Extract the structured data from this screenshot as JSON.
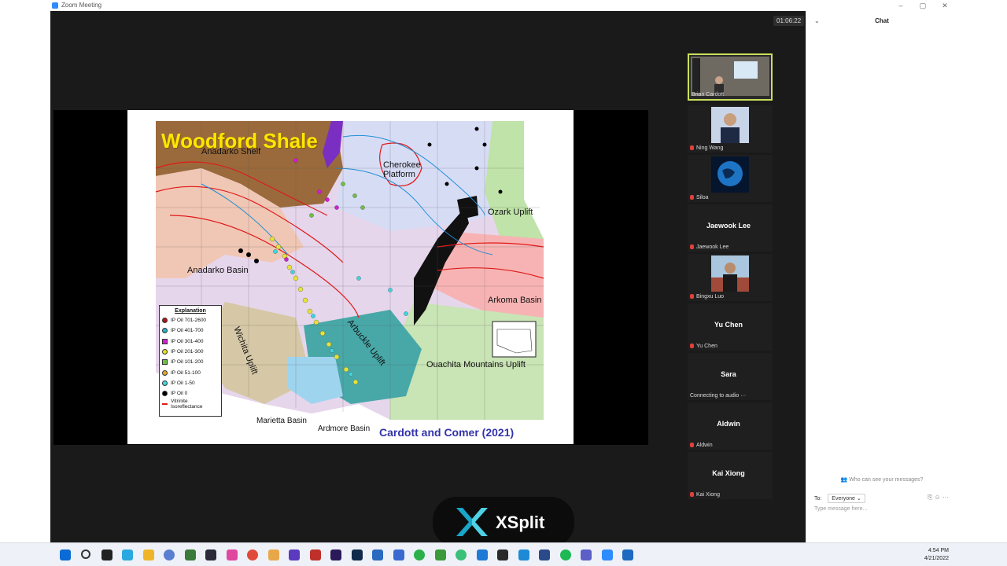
{
  "window": {
    "title": "Zoom Meeting",
    "min_icon": "minimize-icon",
    "max_icon": "maximize-icon",
    "close_icon": "close-icon"
  },
  "meeting": {
    "timer": "01:06:22"
  },
  "slide": {
    "title": "Woodford Shale",
    "credit": "Cardott and Comer (2021)",
    "labels": {
      "anadarko_shelf": "Anadarko Shelf",
      "anadarko_basin": "Anadarko Basin",
      "cherokee": "Cherokee Platform",
      "ozark": "Ozark Uplift",
      "arkoma": "Arkoma Basin",
      "ouachita": "Ouachita Mountains Uplift",
      "arbuckle": "Arbuckle Uplift",
      "wichita": "Wichita Uplift",
      "marietta": "Marietta Basin",
      "ardmore": "Ardmore Basin"
    },
    "legend": {
      "heading": "Explanation",
      "items": [
        {
          "label": "IP Oil 701-2600",
          "color": "#b5121b"
        },
        {
          "label": "IP Oil 401-700",
          "color": "#2bb0c8"
        },
        {
          "label": "IP Oil 301-400",
          "color": "#d21fd2"
        },
        {
          "label": "IP Oil 201-300",
          "color": "#e8e21b"
        },
        {
          "label": "IP Oil 101-200",
          "color": "#6ec043"
        },
        {
          "label": "IP Oil 51-100",
          "color": "#e3a52a"
        },
        {
          "label": "IP Oil 1-50",
          "color": "#3fd6e0"
        },
        {
          "label": "IP Oil 0",
          "color": "#000000"
        },
        {
          "label": "Vitrinite Isoreflectance",
          "color": "#e01a1a"
        }
      ]
    }
  },
  "participants": [
    {
      "name": "Brian Cardott",
      "active": true
    },
    {
      "name": "Ning Wang"
    },
    {
      "name": "Siloa"
    },
    {
      "display": "Jaewook Lee",
      "name": "Jaewook Lee"
    },
    {
      "name": "Bingxu Luo"
    },
    {
      "display": "Yu Chen",
      "name": "Yu Chen"
    },
    {
      "display": "Sara",
      "name": "Connecting to audio ···"
    },
    {
      "display": "Aldwin",
      "name": "Aldwin"
    },
    {
      "display": "Kai Xiong",
      "name": "Kai Xiong"
    }
  ],
  "overlay": {
    "brand": "XSplit"
  },
  "chat": {
    "header": "Chat",
    "who_can_see": "Who can see your messages?",
    "to_label": "To:",
    "to_value": "Everyone",
    "placeholder": "Type message here..."
  },
  "taskbar": {
    "time": "4:54 PM",
    "date": "4/21/2022"
  }
}
